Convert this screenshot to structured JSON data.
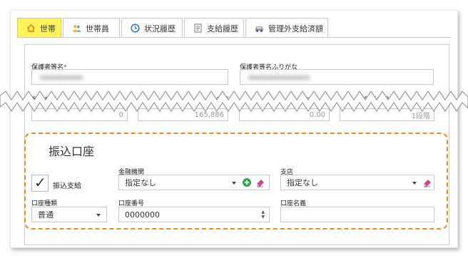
{
  "tabs": [
    {
      "label": "世帯",
      "icon": "home-icon",
      "active": true
    },
    {
      "label": "世帯員",
      "icon": "people-icon",
      "active": false
    },
    {
      "label": "状況履歴",
      "icon": "clock-icon",
      "active": false
    },
    {
      "label": "支給履歴",
      "icon": "document-icon",
      "active": false
    },
    {
      "label": "管理外支給済額",
      "icon": "vehicle-icon",
      "active": false
    }
  ],
  "guardian": {
    "name_label": "保護者等名",
    "required_mark": "*",
    "kana_label": "保護者等名ふりがな"
  },
  "row2": {
    "postal_label": "郵便番号",
    "number_label": "番号",
    "code_label": "コード",
    "phone_label": "電話番号",
    "values": [
      "0",
      "165,886",
      "0.00",
      "1段階"
    ]
  },
  "bank": {
    "section_title": "振込口座",
    "transfer_label": "振込支給",
    "transfer_checked": true,
    "check_glyph": "✓",
    "institution_label": "金融機関",
    "institution_value": "指定なし",
    "branch_label": "支店",
    "branch_value": "指定なし",
    "account_type_label": "口座種類",
    "account_type_value": "普通",
    "account_number_label": "口座番号",
    "account_number_value": "0000000",
    "account_holder_label": "口座名義",
    "account_holder_value": ""
  },
  "colors": {
    "active_tab": "#fff35c",
    "highlight": "#ec8a1a",
    "add_button": "#2ea44f",
    "eraser": "#d9428a"
  }
}
